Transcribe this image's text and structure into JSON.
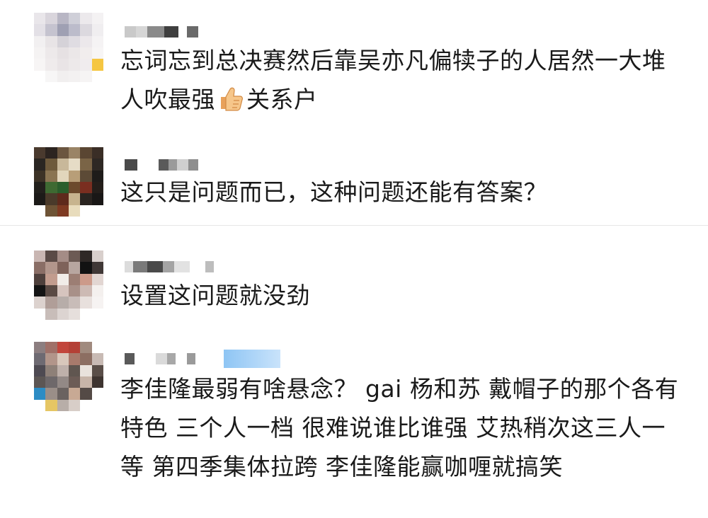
{
  "comments": [
    {
      "text": "忘词忘到总决赛然后靠吴亦凡偏犊子的人居然一大堆人吹最强",
      "emoji": "thumbs-up-icon",
      "text_after": "关系户"
    },
    {
      "text": "这只是问题而已，这种问题还能有答案？"
    },
    {
      "text": "设置这问题就没劲"
    },
    {
      "text": "李佳隆最弱有啥悬念？ gai 杨和苏 戴帽子的那个各有特色 三个人一档 很难说谁比谁强 艾热稍次这三人一等 第四季集体拉跨 李佳隆能赢咖喱就搞笑"
    }
  ]
}
